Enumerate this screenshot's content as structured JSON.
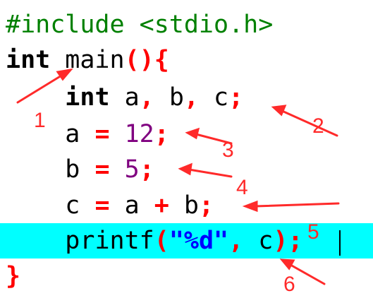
{
  "code": {
    "line1": {
      "directive": "#include <stdio.h>"
    },
    "line2": {
      "kw": "int",
      "name": " main",
      "paren": "()",
      "brace": "{"
    },
    "line3": {
      "indent": "    ",
      "kw": "int",
      "vars1": " a",
      "c1": ",",
      "vars2": " b",
      "c2": ",",
      "vars3": " c",
      "semi": ";"
    },
    "line4": {
      "indent": "    ",
      "lhs": "a ",
      "op": "=",
      "sp": " ",
      "num": "12",
      "semi": ";"
    },
    "line5": {
      "indent": "    ",
      "lhs": "b ",
      "op": "=",
      "sp": " ",
      "num": "5",
      "semi": ";"
    },
    "line6": {
      "indent": "    ",
      "lhs": "c ",
      "op": "=",
      "mid": " a ",
      "plus": "+",
      "rhs": " b",
      "semi": ";"
    },
    "line7": {
      "indent": "    ",
      "fn": "printf",
      "lp": "(",
      "str": "\"%d\"",
      "comma": ",",
      "arg": " c",
      "rp": ")",
      "semi": ";"
    },
    "line8": {
      "brace": "}"
    }
  },
  "annotations": {
    "color": "#ff2a2a",
    "labels": [
      "1",
      "2",
      "3",
      "4",
      "5",
      "6"
    ]
  },
  "highlight_color": "#00ffff"
}
